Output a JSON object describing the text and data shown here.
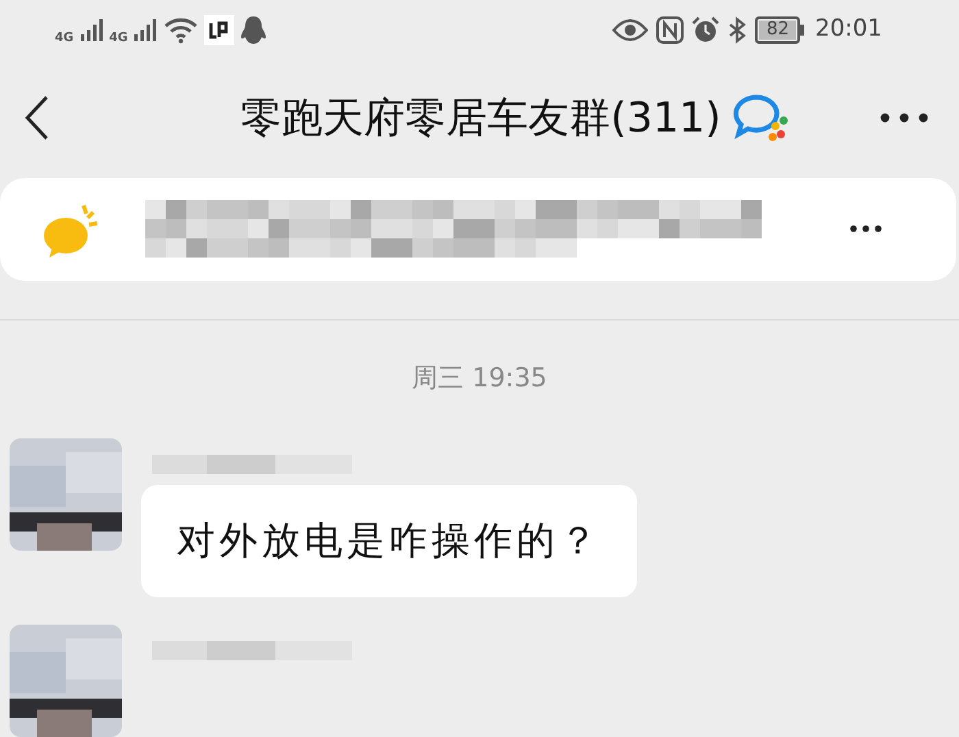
{
  "status_bar": {
    "signals": [
      "4G",
      "4G"
    ],
    "battery": "82",
    "time": "20:01"
  },
  "header": {
    "title": "零跑天府零居车友群(311)"
  },
  "announcement": {
    "kind": "redacted"
  },
  "date_separator": "周三 19:35",
  "messages": [
    {
      "kind": "text",
      "text": "对外放电是咋操作的？"
    },
    {
      "kind": "cut"
    }
  ]
}
